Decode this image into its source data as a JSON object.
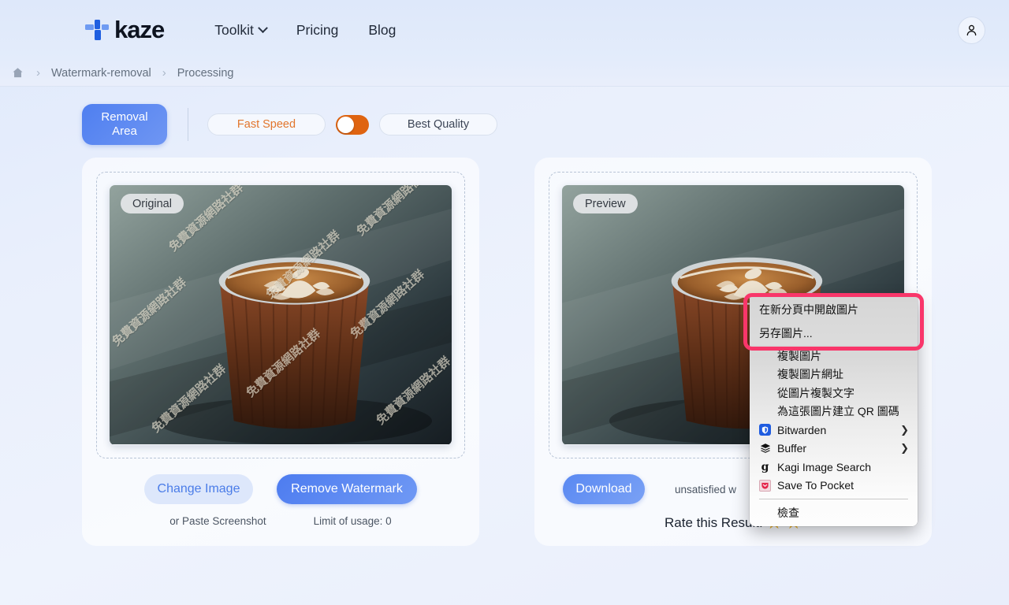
{
  "header": {
    "logo_text": "kaze",
    "nav": [
      {
        "label": "Toolkit",
        "has_chevron": true
      },
      {
        "label": "Pricing",
        "has_chevron": false
      },
      {
        "label": "Blog",
        "has_chevron": false
      }
    ],
    "avatar_icon": "user-icon"
  },
  "breadcrumb": {
    "home_icon": "home-icon",
    "separator": "›",
    "items": [
      "Watermark-removal",
      "Processing"
    ]
  },
  "toolbar": {
    "removal_area_label": "Removal\nArea",
    "removal_area_line1": "Removal",
    "removal_area_line2": "Area",
    "fast_speed_label": "Fast Speed",
    "best_quality_label": "Best Quality",
    "toggle_state": "fast",
    "accent_orange": "#df6411",
    "accent_blue": "#4f7ff0"
  },
  "left_panel": {
    "badge": "Original",
    "watermark_text": "免費資源網路社群",
    "change_image_label": "Change Image",
    "remove_watermark_label": "Remove Watermark",
    "paste_hint": "or Paste Screenshot",
    "limit_text": "Limit of usage: 0"
  },
  "right_panel": {
    "badge": "Preview",
    "download_label": "Download",
    "unsatisfied_text": "unsatisfied w",
    "rate_label": "Rate this Result:",
    "stars_filled": 2,
    "star_glyph": "★"
  },
  "context_menu": {
    "highlighted": [
      "在新分頁中開啟圖片",
      "另存圖片..."
    ],
    "items": [
      {
        "label": "複製圖片",
        "icon": null,
        "arrow": false
      },
      {
        "label": "複製圖片網址",
        "icon": null,
        "arrow": false
      },
      {
        "label": "從圖片複製文字",
        "icon": null,
        "arrow": false
      },
      {
        "label": "為這張圖片建立 QR 圖碼",
        "icon": null,
        "arrow": false
      },
      {
        "label": "Bitwarden",
        "icon": "bitwarden-icon",
        "arrow": true
      },
      {
        "label": "Buffer",
        "icon": "buffer-icon",
        "arrow": true
      },
      {
        "label": "Kagi Image Search",
        "icon": "kagi-icon",
        "arrow": false
      },
      {
        "label": "Save To Pocket",
        "icon": "pocket-icon",
        "arrow": false
      }
    ],
    "footer_item": "檢查",
    "arrow_glyph": "❯",
    "highlight_color": "#f9366a"
  }
}
